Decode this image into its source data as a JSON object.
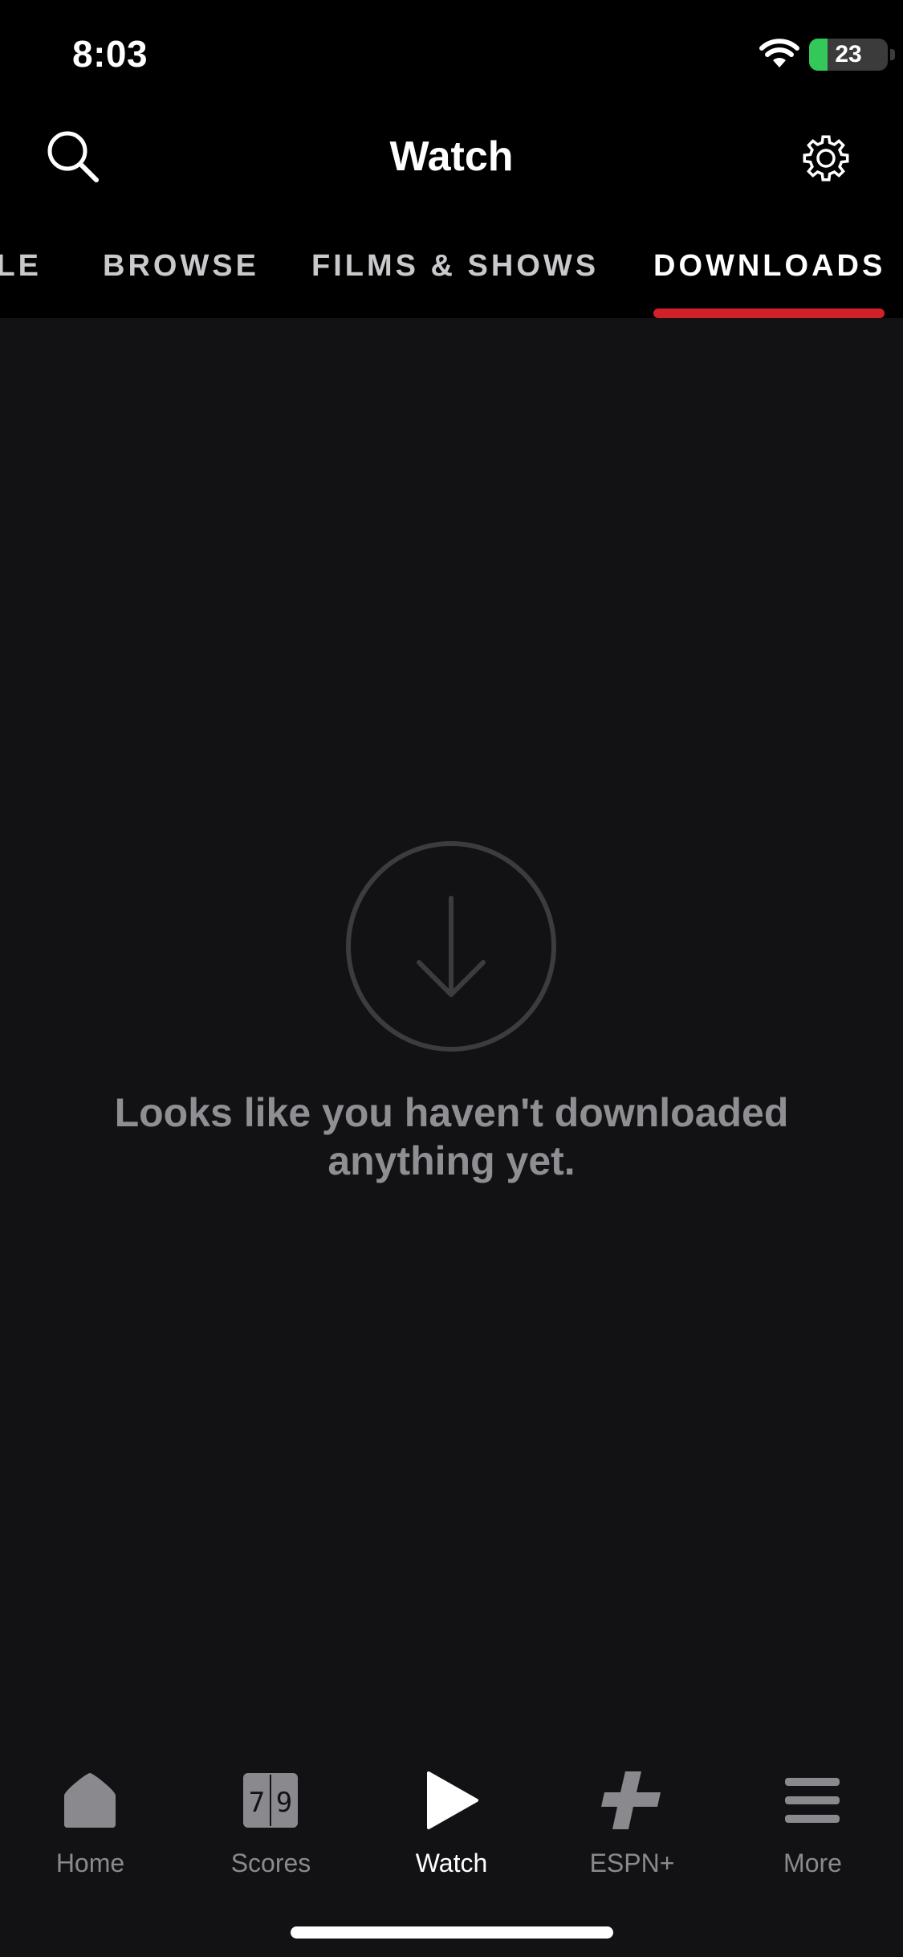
{
  "status_bar": {
    "time": "8:03",
    "battery_level": "23",
    "battery_fraction": 0.23,
    "charging": true
  },
  "header": {
    "title": "Watch"
  },
  "tabs": [
    {
      "label": "LE",
      "active": false
    },
    {
      "label": "BROWSE",
      "active": false
    },
    {
      "label": "FILMS & SHOWS",
      "active": false
    },
    {
      "label": "DOWNLOADS",
      "active": true
    }
  ],
  "empty_state": {
    "message": "Looks like you haven't downloaded anything yet."
  },
  "tab_bar": {
    "items": [
      {
        "label": "Home",
        "icon": "home-icon",
        "active": false
      },
      {
        "label": "Scores",
        "icon": "scores-icon",
        "scores_digits": "79",
        "active": false
      },
      {
        "label": "Watch",
        "icon": "play-icon",
        "active": true
      },
      {
        "label": "ESPN+",
        "icon": "espn-plus-icon",
        "active": false
      },
      {
        "label": "More",
        "icon": "menu-icon",
        "active": false
      }
    ]
  },
  "colors": {
    "accent": "#d0202a",
    "background": "#121214",
    "header_background": "#000000",
    "inactive": "#8a8a8e",
    "battery_green": "#34c759"
  }
}
